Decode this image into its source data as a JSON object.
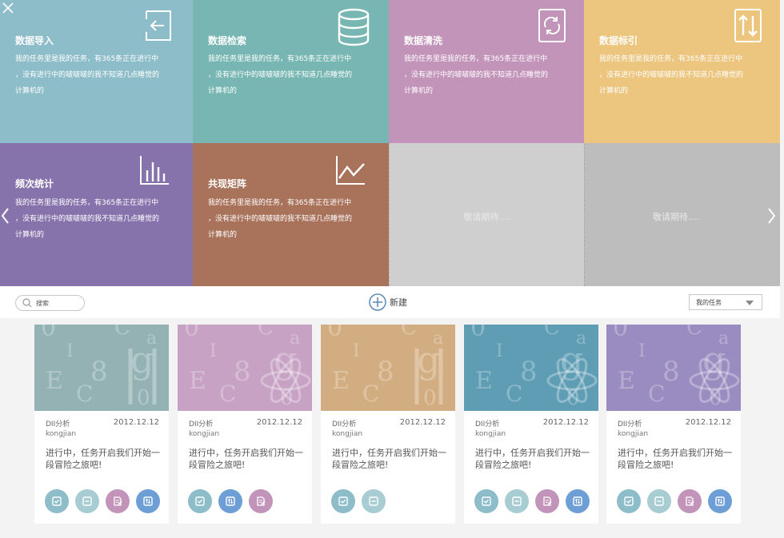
{
  "tiles": [
    {
      "title": "数据导入",
      "desc": "我的任务里是我的任务，有365条正在进行中\n，没有进行中的啵啵啵的我不知道几点睡觉的\n计算机的",
      "color": "#8dbdc9",
      "icon": "import-icon"
    },
    {
      "title": "数据检索",
      "desc": "我的任务里是我的任务，有365条正在进行中\n，没有进行中的啵啵啵的我不知道几点睡觉的\n计算机的",
      "color": "#77b6b2",
      "icon": "database-icon"
    },
    {
      "title": "数据清洗",
      "desc": "我的任务里是我的任务，有365条正在进行中\n，没有进行中的啵啵啵的我不知道几点睡觉的\n计算机的",
      "color": "#c394b9",
      "icon": "refresh-icon"
    },
    {
      "title": "数据标引",
      "desc": "我的任务里是我的任务，有365条正在进行中\n，没有进行中的啵啵啵的我不知道几点睡觉的\n计算机的",
      "color": "#ecc57e",
      "icon": "sort-arrows-icon"
    },
    {
      "title": "频次统计",
      "desc": "我的任务里是我的任务，有365条正在进行中\n，没有进行中的啵啵啵的我不知道几点睡觉的\n计算机的",
      "color": "#8673ac",
      "icon": "bar-chart-icon"
    },
    {
      "title": "共现矩阵",
      "desc": "我的任务里是我的任务，有365条正在进行中\n，没有进行中的啵啵啵的我不知道几点睡觉的\n计算机的",
      "color": "#a8725b",
      "icon": "line-chart-icon"
    }
  ],
  "placeholders": [
    {
      "text": "敬请期待....",
      "color": "#cfcfcf"
    },
    {
      "text": "敬请期待....",
      "color": "#bdbdbd"
    }
  ],
  "toolbar": {
    "search_placeholder": "搜索",
    "new_label": "新建",
    "filter_value": "我的任务"
  },
  "cards": [
    {
      "type": "DII分析",
      "date": "2012.12.12",
      "owner": "kongjian",
      "text": "进行中，任务开启我们开始一段冒险之旅吧!",
      "thumb_color": "#94b2b4",
      "actions": [
        "check-icon",
        "minus-icon",
        "edit-icon",
        "sort-icon"
      ]
    },
    {
      "type": "DII分析",
      "date": "2012.12.12",
      "owner": "kongjian",
      "text": "进行中，任务开启我们开始一段冒险之旅吧!",
      "thumb_color": "#c7a2c4",
      "actions": [
        "check-icon",
        "sort-icon",
        "edit-icon"
      ]
    },
    {
      "type": "DII分析",
      "date": "2012.12.12",
      "owner": "kongjian",
      "text": "进行中，任务开启我们开始一段冒险之旅吧!",
      "thumb_color": "#d3ad82",
      "actions": [
        "check-icon",
        "minus-icon"
      ]
    },
    {
      "type": "DII分析",
      "date": "2012.12.12",
      "owner": "kongjian",
      "text": "进行中，任务开启我们开始一段冒险之旅吧!",
      "thumb_color": "#5f9db5",
      "actions": [
        "check-icon",
        "minus-icon",
        "edit-icon",
        "sort-icon"
      ]
    },
    {
      "type": "DII分析",
      "date": "2012.12.12",
      "owner": "kongjian",
      "text": "进行中，任务开启我们开始一段冒险之旅吧!",
      "thumb_color": "#9a8cc0",
      "actions": [
        "check-icon",
        "minus-icon",
        "edit-icon",
        "sort-icon"
      ]
    }
  ],
  "action_colors": {
    "check-icon": "#8dbdc9",
    "minus-icon": "#a7ccd2",
    "edit-icon": "#c394b9",
    "sort-icon": "#6d9fd6"
  }
}
